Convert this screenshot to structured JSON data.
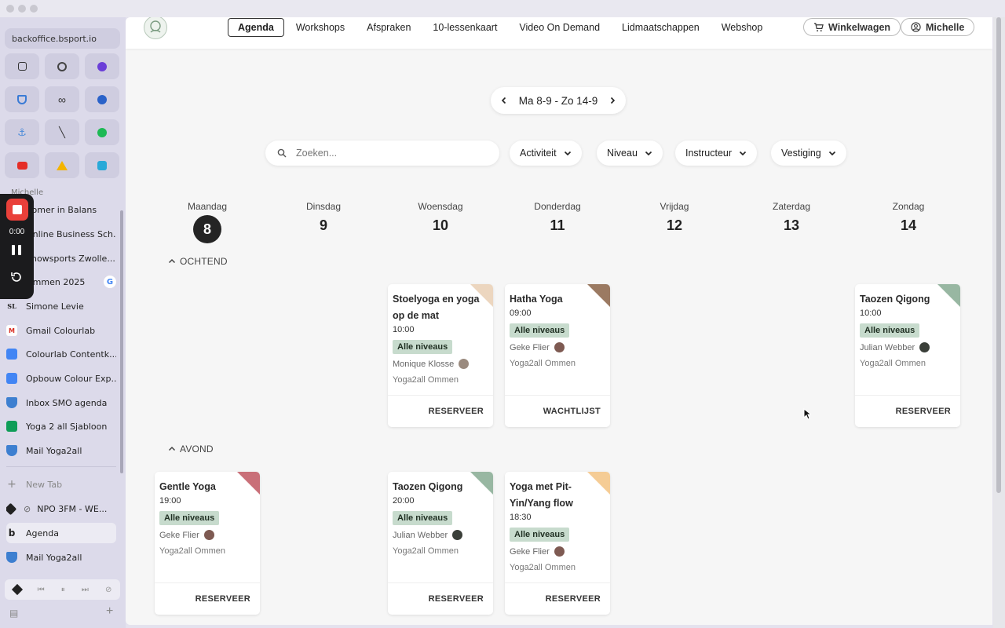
{
  "browser": {
    "url": "backoffice.bsport.io",
    "section_label": "Michelle",
    "tabs": [
      {
        "label": "Zomer in Balans",
        "icon": "green-leaf-icon"
      },
      {
        "label": "Online Business Sch...",
        "icon": "school-icon"
      },
      {
        "label": "Showsports Zwolle...",
        "icon": "sports-icon"
      },
      {
        "label": "Ommen 2025",
        "icon": "doc-icon"
      },
      {
        "label": "Simone Levie",
        "icon": "sl-logo-icon"
      },
      {
        "label": "Gmail Colourlab",
        "icon": "gmail-icon"
      },
      {
        "label": "Colourlab Contentk...",
        "icon": "google-docs-icon"
      },
      {
        "label": "Opbouw Colour Exp...",
        "icon": "google-docs-icon"
      },
      {
        "label": "Inbox SMO agenda",
        "icon": "mail-icon"
      },
      {
        "label": "Yoga 2 all Sjabloon",
        "icon": "google-sheets-icon"
      },
      {
        "label": "Mail Yoga2all",
        "icon": "mail-icon"
      }
    ],
    "new_tab_label": "New Tab",
    "open_tabs": [
      {
        "label": "NPO 3FM - WE...",
        "icon": "npo-icon"
      },
      {
        "label": "Agenda",
        "icon": "bsport-icon"
      },
      {
        "label": "Mail Yoga2all",
        "icon": "mail-icon"
      }
    ]
  },
  "recorder": {
    "time": "0:00"
  },
  "nav": {
    "links": [
      "Agenda",
      "Workshops",
      "Afspraken",
      "10-lessenkaart",
      "Video On Demand",
      "Lidmaatschappen",
      "Webshop"
    ],
    "cart_label": "Winkelwagen",
    "user_label": "Michelle"
  },
  "week": {
    "range": "Ma 8-9 - Zo 14-9"
  },
  "search": {
    "placeholder": "Zoeken..."
  },
  "filters": [
    "Activiteit",
    "Niveau",
    "Instructeur",
    "Vestiging"
  ],
  "days": [
    {
      "name": "Maandag",
      "num": "8"
    },
    {
      "name": "Dinsdag",
      "num": "9"
    },
    {
      "name": "Woensdag",
      "num": "10"
    },
    {
      "name": "Donderdag",
      "num": "11"
    },
    {
      "name": "Vrijdag",
      "num": "12"
    },
    {
      "name": "Zaterdag",
      "num": "13"
    },
    {
      "name": "Zondag",
      "num": "14"
    }
  ],
  "sections": {
    "morning": "OCHTEND",
    "evening": "AVOND"
  },
  "classes": [
    {
      "title": "Stoelyoga en yoga op de mat",
      "time": "10:00",
      "level": "Alle niveaus",
      "instructor": "Monique Klosse",
      "location": "Yoga2all Ommen",
      "action": "RESERVEER",
      "accent": "#ecd6bf"
    },
    {
      "title": "Hatha Yoga",
      "time": "09:00",
      "level": "Alle niveaus",
      "instructor": "Geke Flier",
      "location": "Yoga2all Ommen",
      "action": "WACHTLIJST",
      "accent": "#9b7a62"
    },
    {
      "title": "Taozen Qigong",
      "time": "10:00",
      "level": "Alle niveaus",
      "instructor": "Julian Webber",
      "location": "Yoga2all Ommen",
      "action": "RESERVEER",
      "accent": "#98b7a2"
    },
    {
      "title": "Gentle Yoga",
      "time": "19:00",
      "level": "Alle niveaus",
      "instructor": "Geke Flier",
      "location": "Yoga2all Ommen",
      "action": "RESERVEER",
      "accent": "#c96f78"
    },
    {
      "title": "Taozen Qigong",
      "time": "20:00",
      "level": "Alle niveaus",
      "instructor": "Julian Webber",
      "location": "Yoga2all Ommen",
      "action": "RESERVEER",
      "accent": "#98b7a2"
    },
    {
      "title": "Yoga met Pit-Yin/Yang flow",
      "time": "18:30",
      "level": "Alle niveaus",
      "instructor": "Geke Flier",
      "location": "Yoga2all Ommen",
      "action": "RESERVEER",
      "accent": "#f5cc95"
    }
  ],
  "colors": {
    "today": "#242424",
    "badge": "#c7dbcd",
    "record": "#e9403a"
  }
}
